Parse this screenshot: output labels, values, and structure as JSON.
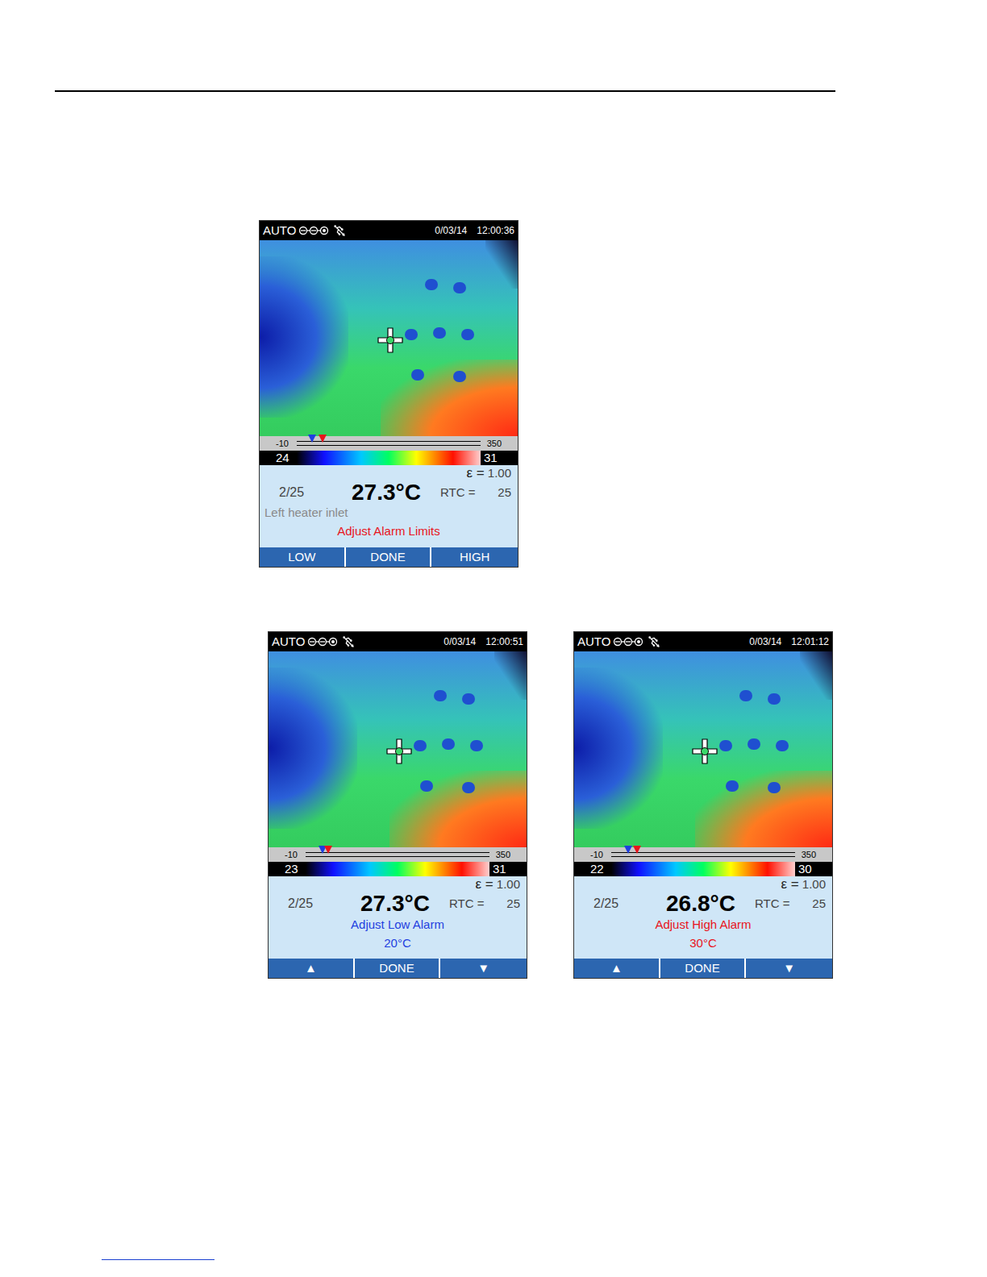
{
  "page": {
    "screens": [
      {
        "status": {
          "mode": "AUTO",
          "date": "0/03/14",
          "time": "12:00:36"
        },
        "scale": {
          "min": "-10",
          "max": "350",
          "span_low": "24",
          "span_high": "31",
          "low_marker": 0.06,
          "high_marker": 0.12
        },
        "info": {
          "emissivity_label": "ε =",
          "emissivity": "1.00",
          "index": "2/25",
          "reading": "27.3°C",
          "rtc_label": "RTC =",
          "rtc": "25",
          "note": "Left heater inlet",
          "message": "Adjust Alarm Limits",
          "message_color": "#e8141c",
          "value": ""
        },
        "buttons": [
          "LOW",
          "DONE",
          "HIGH"
        ]
      },
      {
        "status": {
          "mode": "AUTO",
          "date": "0/03/14",
          "time": "12:00:51"
        },
        "scale": {
          "min": "-10",
          "max": "350",
          "span_low": "23",
          "span_high": "31",
          "low_marker": 0.07,
          "high_marker": 0.1
        },
        "info": {
          "emissivity_label": "ε =",
          "emissivity": "1.00",
          "index": "2/25",
          "reading": "27.3°C",
          "rtc_label": "RTC =",
          "rtc": "25",
          "note": "",
          "message": "Adjust Low Alarm",
          "message_color": "#1f3fe0",
          "value": "20°C"
        },
        "buttons": [
          "▲",
          "DONE",
          "▼"
        ]
      },
      {
        "status": {
          "mode": "AUTO",
          "date": "0/03/14",
          "time": "12:01:12"
        },
        "scale": {
          "min": "-10",
          "max": "350",
          "span_low": "22",
          "span_high": "30",
          "low_marker": 0.07,
          "high_marker": 0.12
        },
        "info": {
          "emissivity_label": "ε =",
          "emissivity": "1.00",
          "index": "2/25",
          "reading": "26.8°C",
          "rtc_label": "RTC =",
          "rtc": "25",
          "note": "",
          "message": "Adjust High Alarm",
          "message_color": "#e8141c",
          "value": "30°C"
        },
        "buttons": [
          "▲",
          "DONE",
          "▼"
        ]
      }
    ]
  }
}
